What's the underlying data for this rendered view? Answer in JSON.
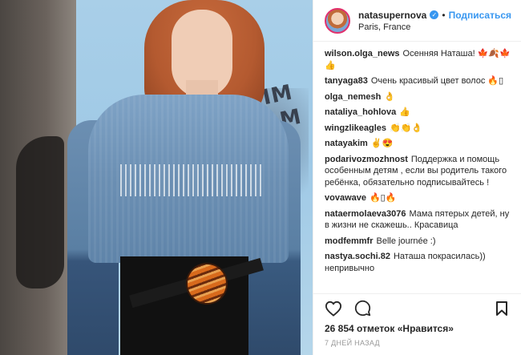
{
  "header": {
    "username": "natasupernova",
    "separator": "•",
    "follow_label": "Подписаться",
    "location": "Paris, France",
    "verified_icon": "verified-badge-icon"
  },
  "photo": {
    "graffiti_text": "GRIM TEAM"
  },
  "comments": [
    {
      "user": "wilson.olga_news",
      "text": "Осенняя Наташа! 🍁🍂🍁👍"
    },
    {
      "user": "tanyaga83",
      "text": "Очень красивый цвет волос 🔥▯"
    },
    {
      "user": "olga_nemesh",
      "text": "👌"
    },
    {
      "user": "nataliya_hohlova",
      "text": "👍"
    },
    {
      "user": "wingzlikeagles",
      "text": "👏👏👌"
    },
    {
      "user": "natayakim",
      "text": "✌️😍"
    },
    {
      "user": "podarivozmozhnost",
      "text": "Поддержка и помощь особенным детям , если вы родитель такого ребёнка, обязательно подписывайтесь !"
    },
    {
      "user": "vovawave",
      "text": "🔥▯🔥"
    },
    {
      "user": "nataermolaeva3076",
      "text": "Мама пятерых детей, ну в жизни не скажешь.. Красавица"
    },
    {
      "user": "modfemmfr",
      "text": "Belle journée :)"
    },
    {
      "user": "nastya.sochi.82",
      "text": "Наташа покрасилась)) непривычно"
    }
  ],
  "actions": {
    "like_icon": "heart-icon",
    "comment_icon": "comment-icon",
    "save_icon": "bookmark-icon"
  },
  "likes_text": "26 854 отметок «Нравится»",
  "timestamp": "7 ДНЕЙ НАЗАД",
  "colors": {
    "link": "#3897f0",
    "text": "#262626",
    "muted": "#999999",
    "border": "#efefef"
  }
}
